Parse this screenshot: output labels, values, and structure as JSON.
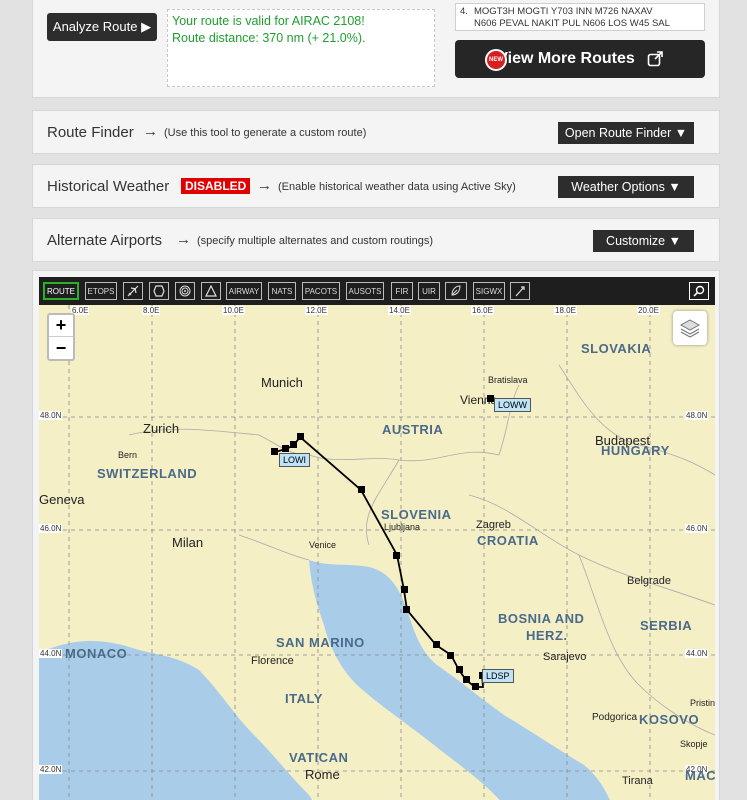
{
  "analyze": {
    "label": "Analyze Route ▶"
  },
  "validation": {
    "line1": "Your route is valid for AIRAC 2108!",
    "line2": "Route distance: 370 nm (+ 21.0%)."
  },
  "routes": {
    "item_number": "4.",
    "line1": "MOGT3H MOGTI Y703 INN M726 NAXAV",
    "line2": "N606 PEVAL NAKIT PUL N606 LOS W45 SAL"
  },
  "more_routes": {
    "label": "View More Routes",
    "badge": "NEW"
  },
  "route_finder": {
    "title": "Route Finder",
    "arrow": "→",
    "note": "(Use this tool to generate a custom route)",
    "button": "Open Route Finder ▼"
  },
  "historical_weather": {
    "title": "Historical Weather",
    "badge": "DISABLED",
    "arrow": "→",
    "note": "(Enable historical weather data using Active Sky)",
    "button": "Weather Options ▼"
  },
  "alternate_airports": {
    "title": "Alternate Airports",
    "arrow": "→",
    "note": "(specify multiple alternates and custom routings)",
    "button": "Customize ▼"
  },
  "toolbar": {
    "route": "ROUTE",
    "etops": "ETOPS",
    "airway": "AIRWAY",
    "nats": "NATS",
    "pacots": "PACOTS",
    "ausots": "AUSOTS",
    "fir": "FIR",
    "uir": "UIR",
    "sigwx": "SIGWX",
    "icons": [
      "airplane-icon",
      "hexagon-icon",
      "radar-icon",
      "triangle-icon",
      "leaf-icon",
      "wind-icon",
      "search-icon"
    ]
  },
  "map": {
    "zoom_in": "+",
    "zoom_out": "−",
    "lon_labels": [
      "6.0E",
      "8.0E",
      "10.0E",
      "12.0E",
      "14.0E",
      "16.0E",
      "18.0E",
      "20.0E"
    ],
    "lat_labels": [
      "48.0N",
      "46.0N",
      "44.0N",
      "42.0N"
    ],
    "countries": [
      "SLOVAKIA",
      "AUSTRIA",
      "HUNGARY",
      "SWITZERLAND",
      "SLOVENIA",
      "CROATIA",
      "MONACO",
      "SAN MARINO",
      "ITALY",
      "BOSNIA AND",
      "HERZ.",
      "SERBIA",
      "KOSOVO",
      "VATICAN",
      "MACEDO"
    ],
    "cities": [
      "Bratislava",
      "Vienna",
      "Munich",
      "Zurich",
      "Bern",
      "Budapest",
      "Geneva",
      "Ljubljana",
      "Zagreb",
      "Milan",
      "Venice",
      "Belgrade",
      "Florence",
      "Sarajevo",
      "Podgorica",
      "Pristina",
      "Skopje",
      "Tirana",
      "Rome"
    ],
    "airports": {
      "origin": "LOWI",
      "destination": "LDSP",
      "vienna": "LOWW"
    }
  },
  "colors": {
    "land": "#f5efc6",
    "sea": "#a9cde9",
    "route": "#000000",
    "valid_text": "#1f9e2f",
    "disabled": "#e00000"
  }
}
